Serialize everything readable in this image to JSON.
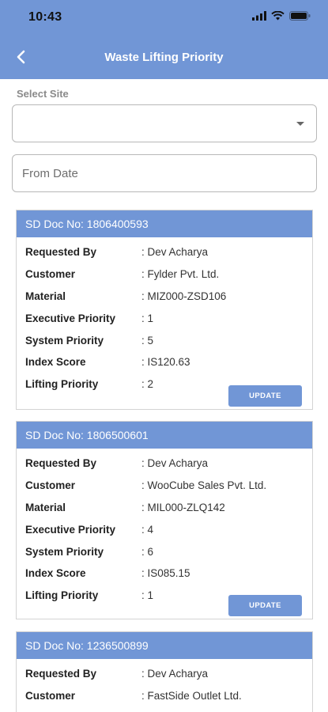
{
  "status": {
    "time": "10:43"
  },
  "header": {
    "title": "Waste Lifting Priority"
  },
  "site": {
    "label": "Select Site",
    "selected": ""
  },
  "from_date": {
    "placeholder": "From Date",
    "value": ""
  },
  "field_labels": {
    "requested_by": "Requested By",
    "customer": "Customer",
    "material": "Material",
    "executive_priority": "Executive Priority",
    "system_priority": "System Priority",
    "index_score": "Index Score",
    "lifting_priority": "Lifting Priority"
  },
  "update_label": "UPDATE",
  "cards": [
    {
      "doc": "SD Doc No: 1806400593",
      "requested_by": ": Dev Acharya",
      "customer": ": Fylder Pvt. Ltd.",
      "material": ": MIZ000-ZSD106",
      "executive_priority": ": 1",
      "system_priority": ": 5",
      "index_score": ": IS120.63",
      "lifting_priority": ": 2"
    },
    {
      "doc": "SD Doc No: 1806500601",
      "requested_by": ": Dev Acharya",
      "customer": ": WooCube Sales Pvt. Ltd.",
      "material": ": MIL000-ZLQ142",
      "executive_priority": ": 4",
      "system_priority": ": 6",
      "index_score": ": IS085.15",
      "lifting_priority": ": 1"
    },
    {
      "doc": "SD Doc No: 1236500899",
      "requested_by": ": Dev Acharya",
      "customer": ": FastSide Outlet Ltd."
    }
  ],
  "colors": {
    "accent": "#7196d6"
  }
}
